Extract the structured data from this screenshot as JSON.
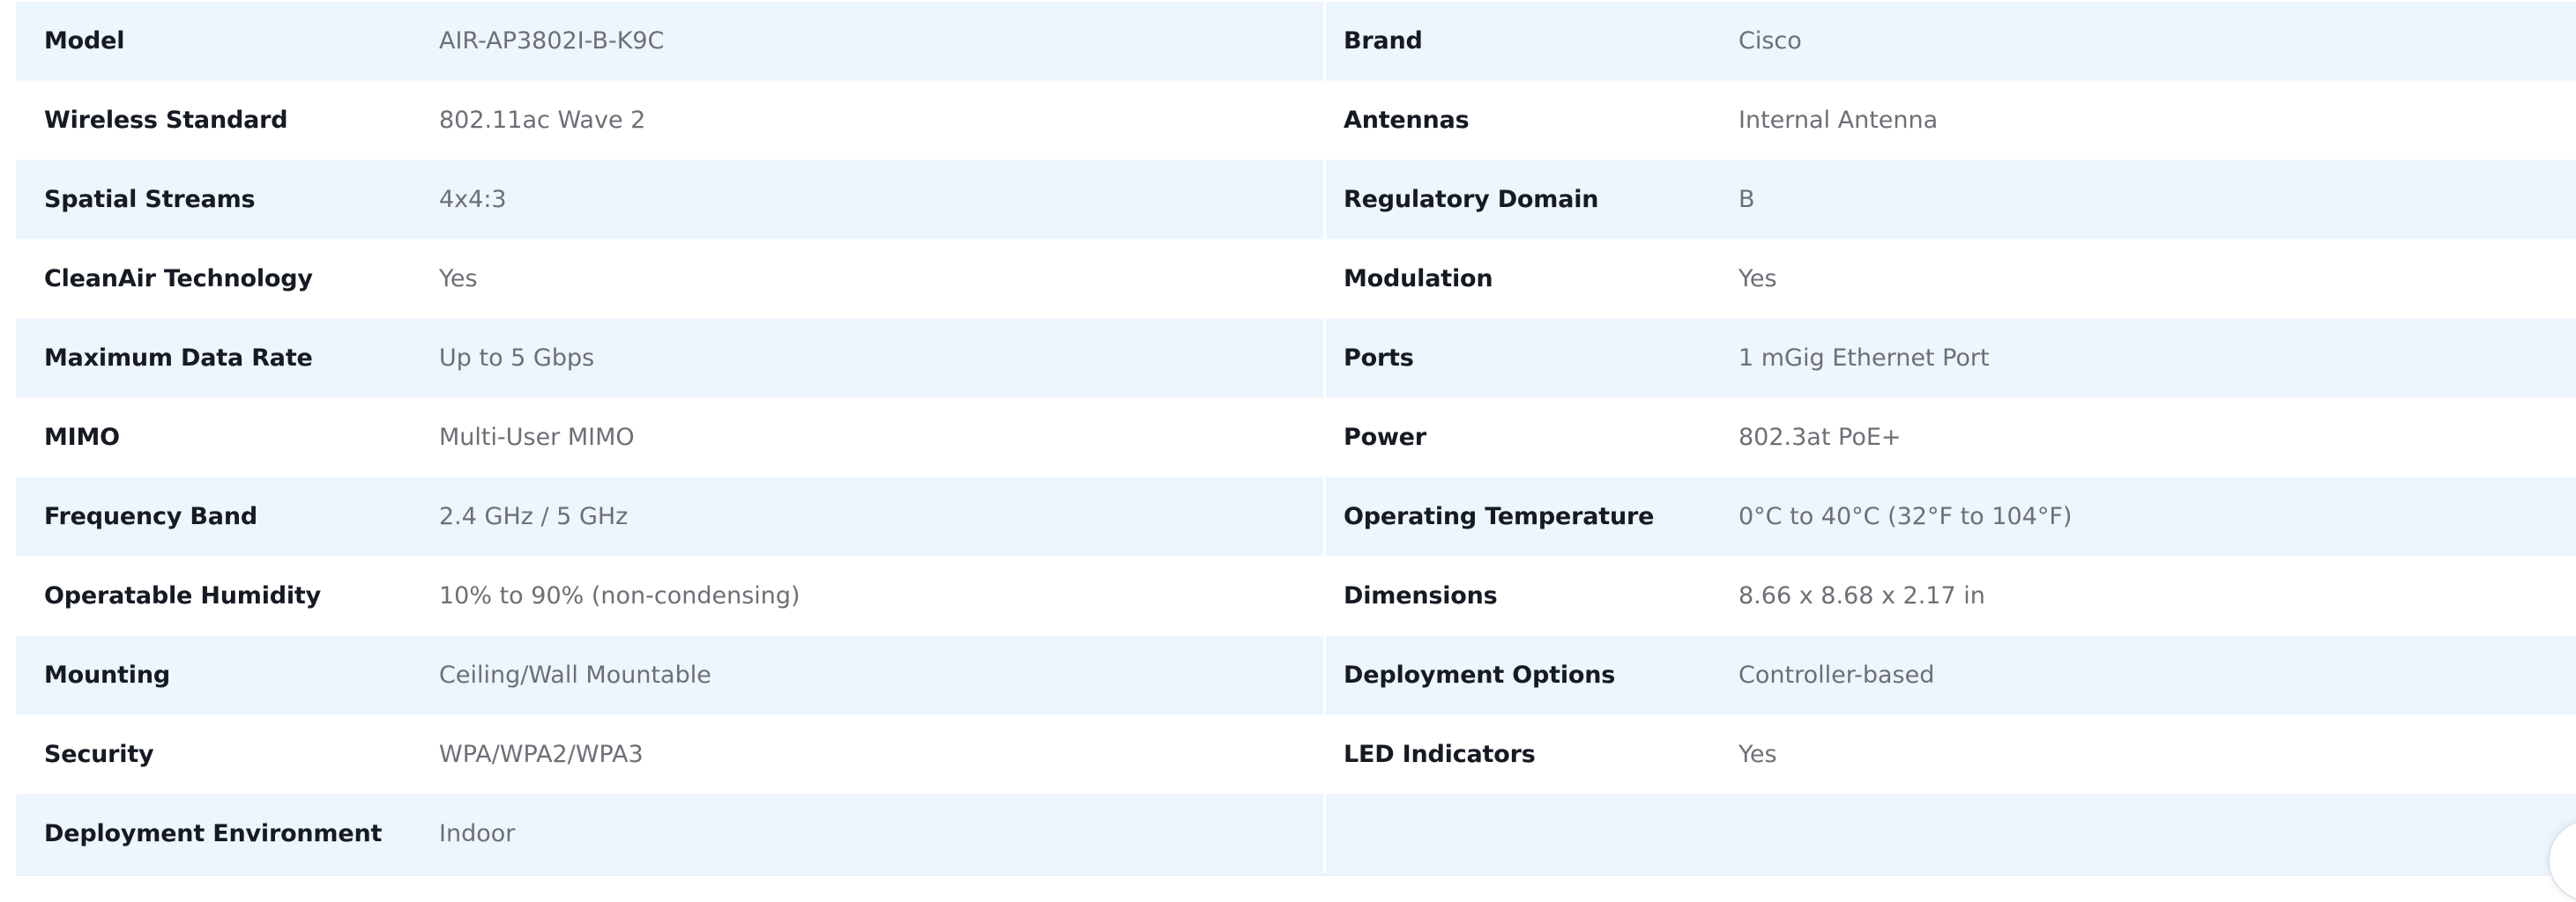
{
  "specs": {
    "left": [
      {
        "label": "Model",
        "value": "AIR-AP3802I-B-K9C"
      },
      {
        "label": "Wireless Standard",
        "value": "802.11ac Wave 2"
      },
      {
        "label": "Spatial Streams",
        "value": "4x4:3"
      },
      {
        "label": "CleanAir Technology",
        "value": "Yes"
      },
      {
        "label": "Maximum Data Rate",
        "value": "Up to 5 Gbps"
      },
      {
        "label": "MIMO",
        "value": "Multi-User MIMO"
      },
      {
        "label": "Frequency Band",
        "value": "2.4 GHz / 5 GHz"
      },
      {
        "label": "Operatable Humidity",
        "value": "10% to 90% (non-condensing)"
      },
      {
        "label": "Mounting",
        "value": "Ceiling/Wall Mountable"
      },
      {
        "label": "Security",
        "value": "WPA/WPA2/WPA3"
      },
      {
        "label": "Deployment Environment",
        "value": "Indoor"
      }
    ],
    "right": [
      {
        "label": "Brand",
        "value": "Cisco"
      },
      {
        "label": "Antennas",
        "value": "Internal Antenna"
      },
      {
        "label": "Regulatory Domain",
        "value": "B"
      },
      {
        "label": "Modulation",
        "value": "Yes"
      },
      {
        "label": "Ports",
        "value": "1 mGig Ethernet Port"
      },
      {
        "label": "Power",
        "value": "802.3at PoE+"
      },
      {
        "label": "Operating Temperature",
        "value": "0°C to 40°C (32°F to 104°F)"
      },
      {
        "label": "Dimensions",
        "value": "8.66 x 8.68 x 2.17 in"
      },
      {
        "label": "Deployment Options",
        "value": "Controller-based"
      },
      {
        "label": "LED Indicators",
        "value": "Yes"
      },
      {
        "label": "",
        "value": ""
      }
    ]
  },
  "colors": {
    "row_tint": "#edf5fe",
    "label_text": "#161a22",
    "value_text": "#6d6f76"
  }
}
